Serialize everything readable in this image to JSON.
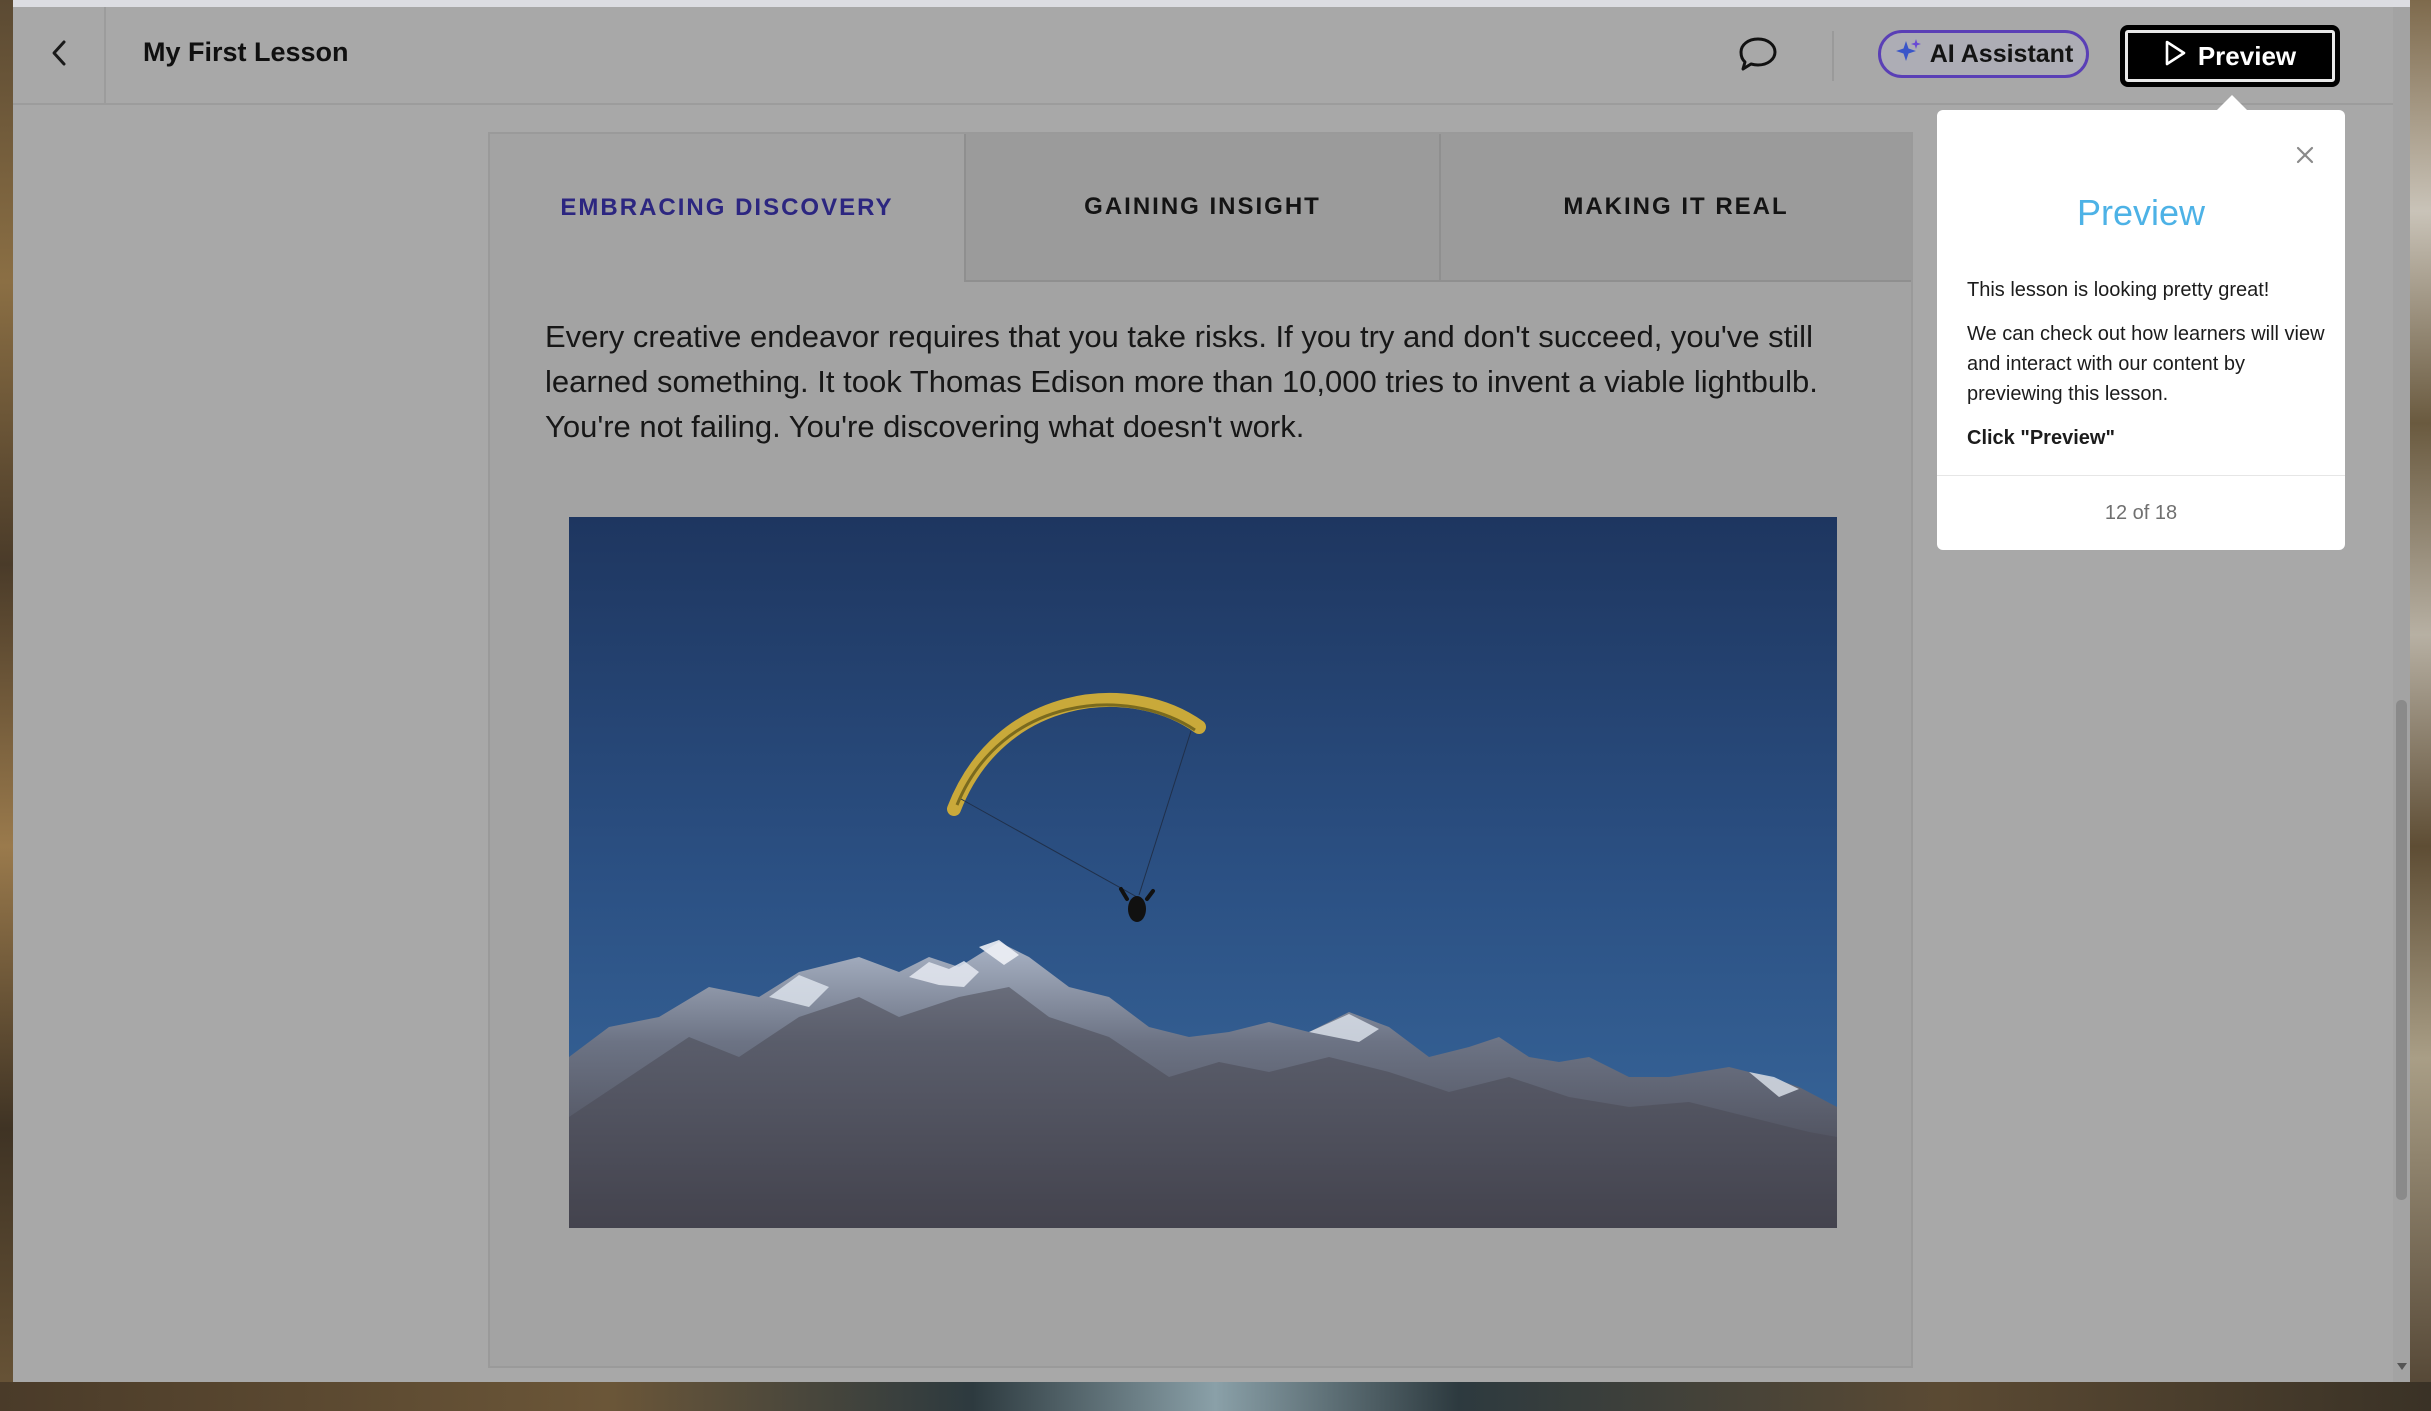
{
  "header": {
    "title": "My First Lesson",
    "ai_button_label": "AI Assistant",
    "preview_button_label": "Preview"
  },
  "tabs": [
    {
      "label": "EMBRACING DISCOVERY",
      "active": true
    },
    {
      "label": "GAINING INSIGHT",
      "active": false
    },
    {
      "label": "MAKING IT REAL",
      "active": false
    }
  ],
  "content": {
    "body_text": "Every creative endeavor requires that you take risks. If you try and don't succeed, you've still learned something. It took Thomas Edison more than 10,000 tries to invent a viable lightbulb. You're not failing. You're discovering what doesn't work."
  },
  "tooltip": {
    "title": "Preview",
    "paragraph_1": "This lesson is looking pretty great!",
    "paragraph_2": "We can check out how learners will view and interact with our content by previewing this lesson.",
    "cta": "Click \"Preview\"",
    "step": "12 of 18"
  },
  "icons": {
    "back": "chevron-left-icon",
    "comment": "comment-icon",
    "ai": "sparkle-icon",
    "preview": "play-icon",
    "close": "close-icon"
  },
  "colors": {
    "active_tab": "#2c2680",
    "ai_border": "#5a3fb6",
    "tooltip_title": "#4db2e6",
    "preview_button_bg": "#000000"
  }
}
